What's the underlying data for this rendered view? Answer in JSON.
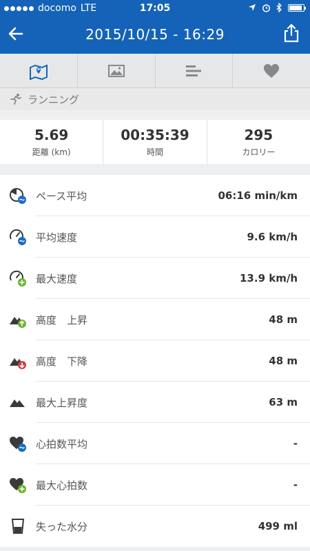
{
  "status_bar": {
    "carrier": "docomo",
    "network": "LTE",
    "time": "17:05",
    "signal_bars": 5,
    "battery_level": 0.9
  },
  "nav": {
    "title": "2015/10/15 - 16:29",
    "back_icon": "back-arrow-icon",
    "share_icon": "share-icon"
  },
  "tabs": [
    {
      "icon": "map-icon",
      "active": true
    },
    {
      "icon": "image-icon",
      "active": false
    },
    {
      "icon": "bars-icon",
      "active": false
    },
    {
      "icon": "heart-icon",
      "active": false
    }
  ],
  "activity": {
    "label": "ランニング",
    "icon": "running-icon"
  },
  "summary": [
    {
      "value": "5.69",
      "label": "距離 (km)"
    },
    {
      "value": "00:35:39",
      "label": "時間"
    },
    {
      "value": "295",
      "label": "カロリー"
    }
  ],
  "stats": [
    {
      "label": "ペース平均",
      "value": "06:16 min/km",
      "icon": "pace-average-icon"
    },
    {
      "label": "平均速度",
      "value": "9.6 km/h",
      "icon": "speed-average-icon"
    },
    {
      "label": "最大速度",
      "value": "13.9 km/h",
      "icon": "speed-max-icon"
    },
    {
      "label": "高度　上昇",
      "value": "48 m",
      "icon": "elevation-up-icon"
    },
    {
      "label": "高度　下降",
      "value": "48 m",
      "icon": "elevation-down-icon"
    },
    {
      "label": "最大上昇度",
      "value": "63 m",
      "icon": "elevation-max-icon"
    },
    {
      "label": "心拍数平均",
      "value": "-",
      "icon": "heart-rate-average-icon"
    },
    {
      "label": "最大心拍数",
      "value": "-",
      "icon": "heart-rate-max-icon"
    },
    {
      "label": "失った水分",
      "value": "499 ml",
      "icon": "water-loss-icon"
    }
  ],
  "colors": {
    "brand_blue": "#1463b8",
    "badge_blue": "#1a6cc4",
    "badge_green": "#6ab42a",
    "badge_red": "#d23c3c",
    "icon_dark": "#3a3a3a"
  }
}
